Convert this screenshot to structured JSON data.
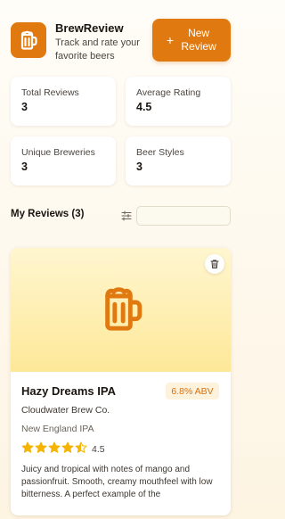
{
  "app": {
    "title": "BrewReview",
    "subtitle": "Track and rate your favorite beers",
    "logo_icon": "beer-mug-icon",
    "accent_color": "#e07a10"
  },
  "header": {
    "new_review_label": "New Review",
    "new_review_icon": "plus-icon"
  },
  "stats": [
    {
      "label": "Total Reviews",
      "value": "3"
    },
    {
      "label": "Average Rating",
      "value": "4.5"
    },
    {
      "label": "Unique Breweries",
      "value": "3"
    },
    {
      "label": "Beer Styles",
      "value": "3"
    }
  ],
  "reviews_section": {
    "title": "My Reviews (3)",
    "filter_icon": "sliders-icon",
    "search_placeholder": ""
  },
  "reviews": [
    {
      "name": "Hazy Dreams IPA",
      "abv": "6.8% ABV",
      "brewery": "Cloudwater Brew Co.",
      "style": "New England IPA",
      "rating": 4.5,
      "rating_label": "4.5",
      "description": "Juicy and tropical with notes of mango and passionfruit. Smooth, creamy mouthfeel with low bitterness. A perfect example of the",
      "image_icon": "beer-mug-icon",
      "delete_icon": "trash-icon",
      "star_color": "#f4b400"
    }
  ]
}
